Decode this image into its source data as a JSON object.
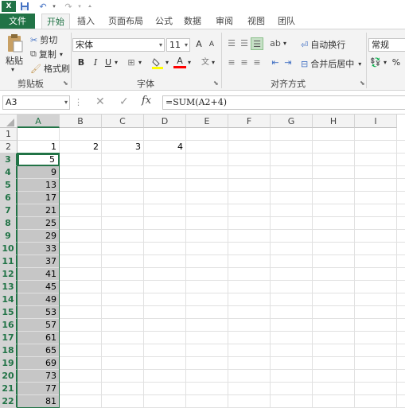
{
  "qat": {
    "icons": [
      "excel-logo-icon",
      "save-icon",
      "undo-icon",
      "redo-icon",
      "customize-icon"
    ]
  },
  "tabs": [
    "文件",
    "开始",
    "插入",
    "页面布局",
    "公式",
    "数据",
    "审阅",
    "视图",
    "团队"
  ],
  "ribbon": {
    "clipboard": {
      "paste": "粘贴",
      "cut": "剪切",
      "copy": "复制",
      "format_painter": "格式刷",
      "group": "剪贴板"
    },
    "font": {
      "name": "宋体",
      "size": "11",
      "bold": "B",
      "italic": "I",
      "underline": "U",
      "grow": "A",
      "shrink": "A",
      "font_color": "A",
      "group": "字体"
    },
    "alignment": {
      "wrap": "自动换行",
      "merge": "合并后居中",
      "group": "对齐方式"
    },
    "number": {
      "format": "常规",
      "percent": "%"
    }
  },
  "formula_bar": {
    "name_box": "A3",
    "fx": "fx",
    "formula": "=SUM(A2+4)"
  },
  "grid": {
    "columns": [
      "A",
      "B",
      "C",
      "D",
      "E",
      "F",
      "G",
      "H",
      "I"
    ],
    "rows": [
      "1",
      "2",
      "3",
      "4",
      "5",
      "6",
      "7",
      "8",
      "9",
      "10",
      "11",
      "12",
      "13",
      "14",
      "15",
      "16",
      "17",
      "18",
      "19",
      "20",
      "21",
      "22"
    ],
    "row2": {
      "A": "1",
      "B": "2",
      "C": "3",
      "D": "4"
    },
    "colA": [
      "5",
      "9",
      "13",
      "17",
      "21",
      "25",
      "29",
      "33",
      "37",
      "41",
      "45",
      "49",
      "53",
      "57",
      "61",
      "65",
      "69",
      "73",
      "77",
      "81"
    ]
  }
}
